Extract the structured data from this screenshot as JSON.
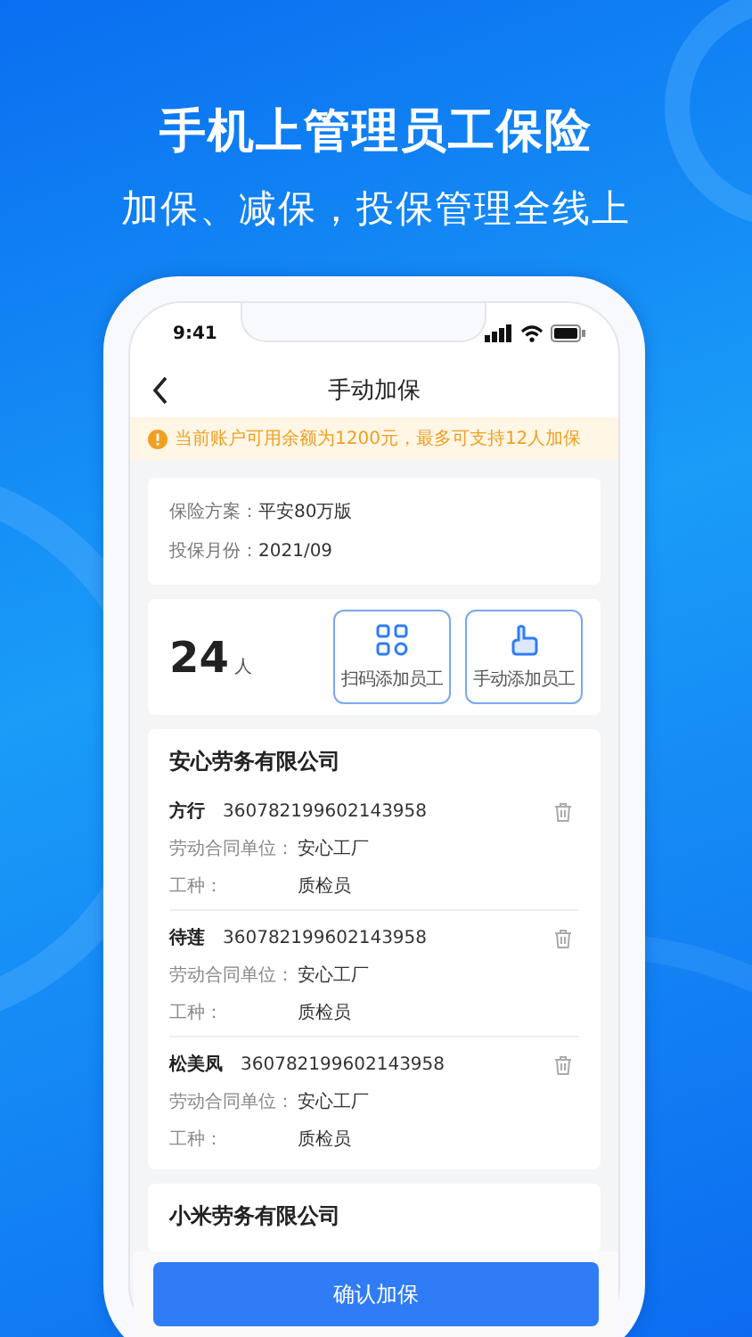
{
  "headline": "手机上管理员工保险",
  "subheadline": "加保、减保，投保管理全线上",
  "status_bar": {
    "time": "9:41"
  },
  "nav": {
    "title": "手动加保"
  },
  "notice": "当前账户可用余额为1200元，最多可支持12人加保",
  "plan": [
    {
      "label": "保险方案：",
      "value": "平安80万版"
    },
    {
      "label": "投保月份：",
      "value": "2021/09"
    }
  ],
  "count": {
    "number": "24",
    "unit": "人"
  },
  "actions": [
    {
      "kind": "scan",
      "label": "扫码添加员工"
    },
    {
      "kind": "manual",
      "label": "手动添加员工"
    }
  ],
  "companies": [
    {
      "name": "安心劳务有限公司",
      "employees": [
        {
          "name": "方行",
          "id": "360782199602143958",
          "fields": [
            {
              "label": "劳动合同单位：",
              "value": "安心工厂"
            },
            {
              "label": "工种：",
              "value": "质检员"
            }
          ]
        },
        {
          "name": "待莲",
          "id": "360782199602143958",
          "fields": [
            {
              "label": "劳动合同单位：",
              "value": "安心工厂"
            },
            {
              "label": "工种：",
              "value": "质检员"
            }
          ]
        },
        {
          "name": "松美凤",
          "id": "360782199602143958",
          "fields": [
            {
              "label": "劳动合同单位：",
              "value": "安心工厂"
            },
            {
              "label": "工种：",
              "value": "质检员"
            }
          ]
        }
      ]
    },
    {
      "name": "小米劳务有限公司"
    }
  ],
  "confirm_button": "确认加保"
}
